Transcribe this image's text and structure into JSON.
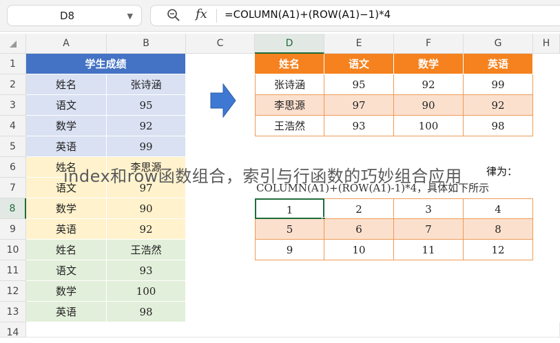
{
  "formula_bar": {
    "name_box": "D8",
    "fx": "fx",
    "formula": "=COLUMN(A1)+(ROW(A1)−1)*4"
  },
  "columns": [
    "A",
    "B",
    "C",
    "D",
    "E",
    "F",
    "G",
    "H"
  ],
  "rows": [
    "1",
    "2",
    "3",
    "4",
    "5",
    "6",
    "7",
    "8",
    "9",
    "10",
    "11",
    "12",
    "13",
    "14"
  ],
  "left_table": {
    "title": "学生成绩",
    "rows": [
      [
        "姓名",
        "张诗涵"
      ],
      [
        "语文",
        "95"
      ],
      [
        "数学",
        "92"
      ],
      [
        "英语",
        "99"
      ],
      [
        "姓名",
        "李思源"
      ],
      [
        "语文",
        "97"
      ],
      [
        "数学",
        "90"
      ],
      [
        "英语",
        "92"
      ],
      [
        "姓名",
        "王浩然"
      ],
      [
        "语文",
        "93"
      ],
      [
        "数学",
        "100"
      ],
      [
        "英语",
        "98"
      ]
    ]
  },
  "right_table": {
    "headers": [
      "姓名",
      "语文",
      "数学",
      "英语"
    ],
    "rows": [
      [
        "张诗涵",
        "95",
        "92",
        "99"
      ],
      [
        "李思源",
        "97",
        "90",
        "92"
      ],
      [
        "王浩然",
        "93",
        "100",
        "98"
      ]
    ]
  },
  "note": {
    "line1_end": "律为：",
    "line2": "COLUMN(A1)+(ROW(A1)-1)*4，具体如下所示"
  },
  "index_table": {
    "rows": [
      [
        "1",
        "2",
        "3",
        "4"
      ],
      [
        "5",
        "6",
        "7",
        "8"
      ],
      [
        "9",
        "10",
        "11",
        "12"
      ]
    ]
  },
  "overlay_caption": "index和row函数组合，索引与行函数的巧妙组合应用",
  "colors": {
    "accent_green": "#1e6b3a",
    "header_blue": "#4472c4",
    "header_orange": "#f5821f",
    "arrow_blue": "#3f78d3"
  }
}
